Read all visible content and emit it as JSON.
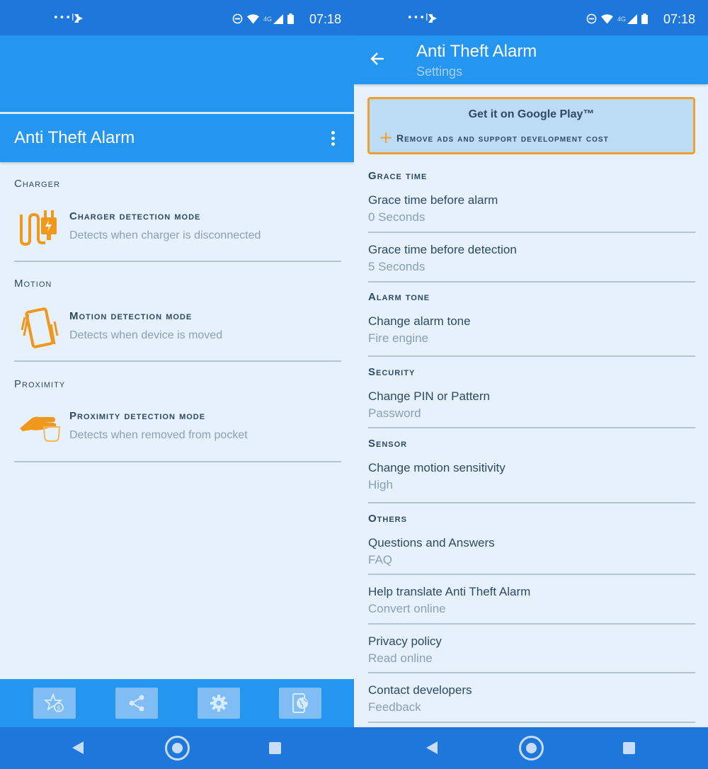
{
  "status_bar": {
    "time": "07:18",
    "network": "4G",
    "dots": "•••l"
  },
  "left": {
    "title": "Anti Theft Alarm",
    "sections": [
      {
        "label": "Charger",
        "title": "Charger detection mode",
        "subtitle": "Detects when charger is disconnected"
      },
      {
        "label": "Motion",
        "title": "Motion detection mode",
        "subtitle": "Detects when device is moved"
      },
      {
        "label": "Proximity",
        "title": "Proximity detection mode",
        "subtitle": "Detects when removed from pocket"
      }
    ],
    "bottom_buttons": [
      "rate-star-icon",
      "share-icon",
      "settings-gear-icon",
      "phone-globe-icon"
    ]
  },
  "right": {
    "title": "Anti Theft Alarm",
    "subtitle": "Settings",
    "promo": {
      "title": "Get it on Google Play™",
      "subtitle": "Remove ads and support development cost"
    },
    "sections": [
      {
        "header": "Grace time",
        "items": [
          {
            "title": "Grace time before alarm",
            "value": "0 Seconds"
          },
          {
            "title": "Grace time before detection",
            "value": "5 Seconds"
          }
        ]
      },
      {
        "header": "Alarm tone",
        "items": [
          {
            "title": "Change alarm tone",
            "value": "Fire engine"
          }
        ]
      },
      {
        "header": "Security",
        "items": [
          {
            "title": "Change PIN or Pattern",
            "value": "Password"
          }
        ]
      },
      {
        "header": "Sensor",
        "items": [
          {
            "title": "Change motion sensitivity",
            "value": "High"
          }
        ]
      },
      {
        "header": "Others",
        "items": [
          {
            "title": "Questions and Answers",
            "value": "FAQ"
          },
          {
            "title": "Help translate Anti Theft Alarm",
            "value": "Convert online"
          },
          {
            "title": "Privacy policy",
            "value": "Read online"
          },
          {
            "title": "Contact developers",
            "value": "Feedback"
          }
        ]
      }
    ]
  },
  "colors": {
    "primary": "#2596f0",
    "status_bar": "#1e78dc",
    "background": "#e6f1fb",
    "accent": "#f0a030",
    "text_dark": "#2d4a63",
    "text_muted": "#8aa0b3"
  }
}
